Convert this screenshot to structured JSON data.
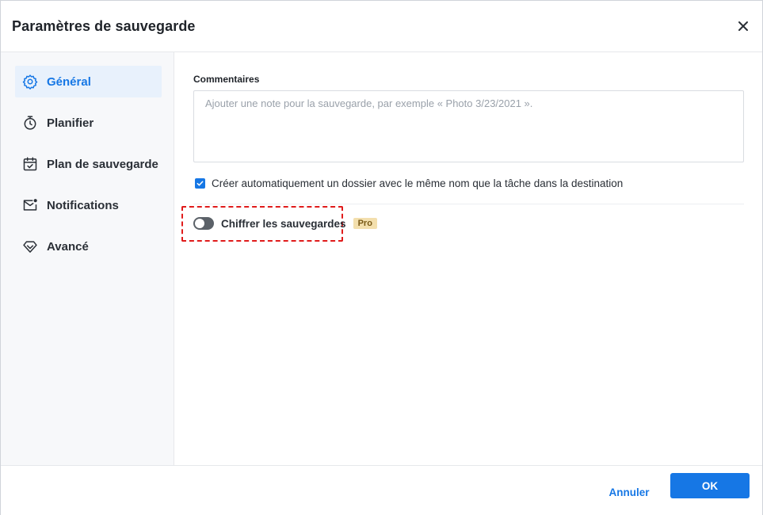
{
  "dialog": {
    "title": "Paramètres de sauvegarde",
    "close_icon": "close-icon"
  },
  "sidebar": {
    "items": [
      {
        "label": "Général",
        "icon": "gear-icon",
        "active": true
      },
      {
        "label": "Planifier",
        "icon": "stopwatch-icon",
        "active": false
      },
      {
        "label": "Plan de sauvegarde",
        "icon": "calendar-check-icon",
        "active": false
      },
      {
        "label": "Notifications",
        "icon": "mail-notification-icon",
        "active": false
      },
      {
        "label": "Avancé",
        "icon": "diamond-icon",
        "active": false
      }
    ]
  },
  "general": {
    "comments_label": "Commentaires",
    "comments_value": "",
    "comments_placeholder": "Ajouter une note pour la sauvegarde, par exemple « Photo 3/23/2021 ».",
    "auto_folder_label": "Créer automatiquement un dossier avec le même nom que la tâche dans la destination",
    "auto_folder_checked": true,
    "encrypt_label": "Chiffrer les sauvegardes",
    "encrypt_enabled": false,
    "pro_badge": "Pro"
  },
  "footer": {
    "cancel_label": "Annuler",
    "ok_label": "OK"
  },
  "colors": {
    "accent": "#1677e5",
    "highlight": "#e01b1b",
    "pro_badge_bg": "#f3dfad"
  }
}
